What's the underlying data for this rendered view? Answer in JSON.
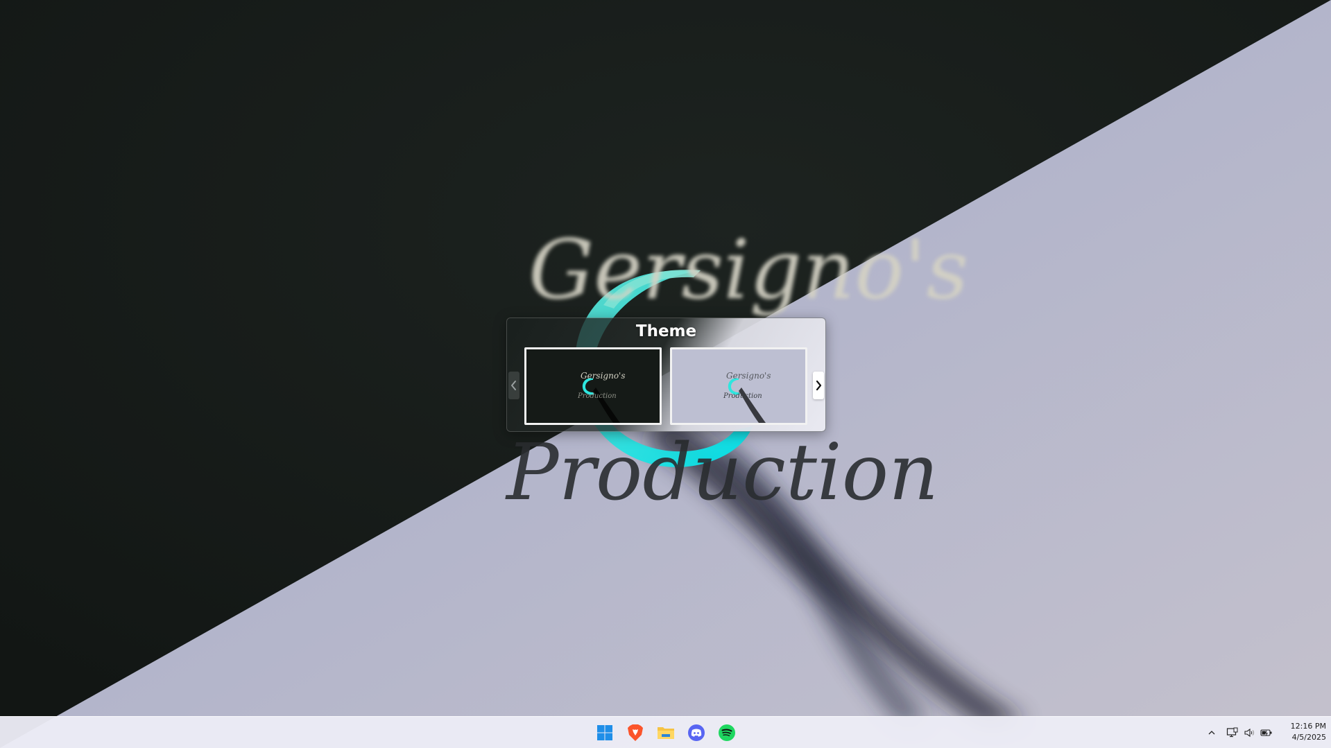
{
  "wallpaper": {
    "logo_line1": "Gersigno's",
    "logo_line2": "Production",
    "dark_color": "#161b18",
    "light_color": "#b9bace",
    "accent_color": "#2ee6df"
  },
  "theme_popup": {
    "title": "Theme",
    "options": [
      {
        "name": "dark-theme",
        "logo_line1": "Gersigno's",
        "logo_line2": "Production"
      },
      {
        "name": "light-theme",
        "logo_line1": "Gersigno's",
        "logo_line2": "Production"
      }
    ],
    "prev_icon": "chevron-left-icon",
    "next_icon": "chevron-right-icon"
  },
  "taskbar": {
    "pinned": [
      {
        "name": "start",
        "icon": "windows-start-icon"
      },
      {
        "name": "brave",
        "icon": "brave-browser-icon"
      },
      {
        "name": "file-explorer",
        "icon": "folder-icon"
      },
      {
        "name": "discord",
        "icon": "discord-icon"
      },
      {
        "name": "spotify",
        "icon": "spotify-icon"
      }
    ],
    "tray": {
      "chevron_icon": "chevron-up-icon",
      "network_icon": "network-icon",
      "volume_icon": "speaker-icon",
      "battery_icon": "battery-icon"
    },
    "clock": {
      "time": "12:16 PM",
      "date": "4/5/2025"
    }
  }
}
